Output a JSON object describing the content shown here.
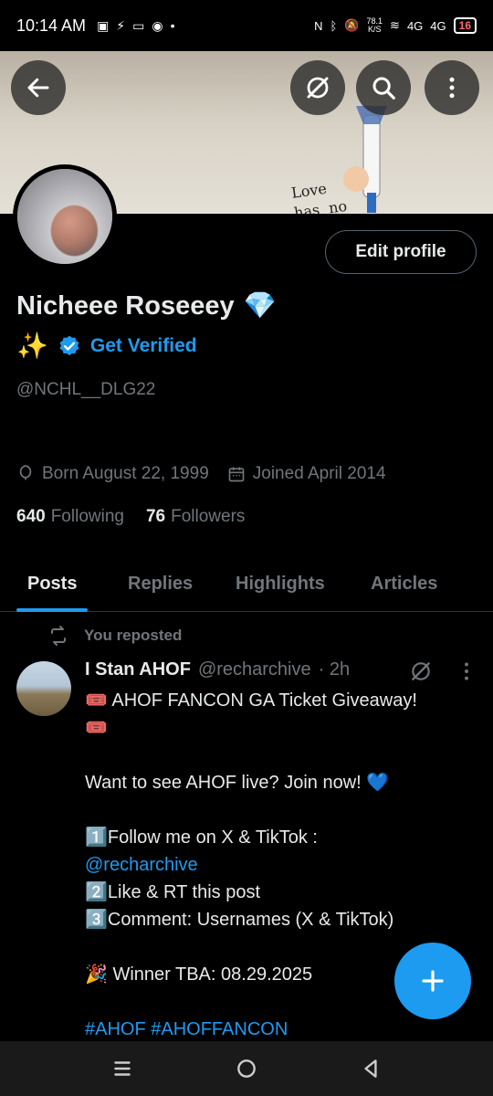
{
  "status_bar": {
    "time": "10:14 AM",
    "net_speed_top": "78.1",
    "net_speed_unit": "K/S",
    "signal1": "4G",
    "signal2": "4G",
    "battery": "16",
    "icons": [
      "sim-icon",
      "flash-icon",
      "tv-icon",
      "messenger-icon",
      "dot-icon",
      "nfc-icon",
      "bluetooth-icon",
      "mute-icon",
      "wifi-icon"
    ]
  },
  "header": {
    "back_icon": "back-arrow-icon",
    "banner_text": "Love\nhas  no\nborders."
  },
  "profile": {
    "edit_button": "Edit profile",
    "name": "Nicheee Roseeey",
    "name_emoji": "💎",
    "sparkle_emoji": "✨",
    "get_verified": "Get Verified",
    "handle": "@NCHL__DLG22",
    "born": "Born August 22, 1999",
    "joined": "Joined April 2014",
    "following_count": "640",
    "following_label": "Following",
    "followers_count": "76",
    "followers_label": "Followers"
  },
  "tabs": [
    {
      "label": "Posts",
      "active": true
    },
    {
      "label": "Replies",
      "active": false
    },
    {
      "label": "Highlights",
      "active": false
    },
    {
      "label": "Articles",
      "active": false
    }
  ],
  "post": {
    "repost_label": "You reposted",
    "author_name": "I Stan AHOF",
    "author_handle": "@recharchive",
    "time": "· 2h",
    "lines": [
      {
        "text": "🎟️ AHOF FANCON GA Ticket Giveaway!",
        "link": false
      },
      {
        "text": "🎟️",
        "link": false
      },
      {
        "text": "",
        "link": false
      },
      {
        "text": "Want to see AHOF live? Join now! 💙",
        "link": false
      },
      {
        "text": "",
        "link": false
      },
      {
        "text": "1️⃣Follow me on X & TikTok :",
        "link": false
      },
      {
        "text": "@recharchive",
        "link": true
      },
      {
        "text": "2️⃣Like & RT this post",
        "link": false
      },
      {
        "text": "3️⃣Comment: Usernames (X & TikTok)",
        "link": false
      },
      {
        "text": "",
        "link": false
      },
      {
        "text": "🎉 Winner TBA: 08.29.2025",
        "link": false
      },
      {
        "text": "",
        "link": false
      },
      {
        "text": "#AHOF #AHOFFANCON",
        "link": true
      }
    ]
  },
  "colors": {
    "accent": "#1d9bf0",
    "muted": "#71767b",
    "text": "#e7e9ea",
    "background": "#000000"
  }
}
